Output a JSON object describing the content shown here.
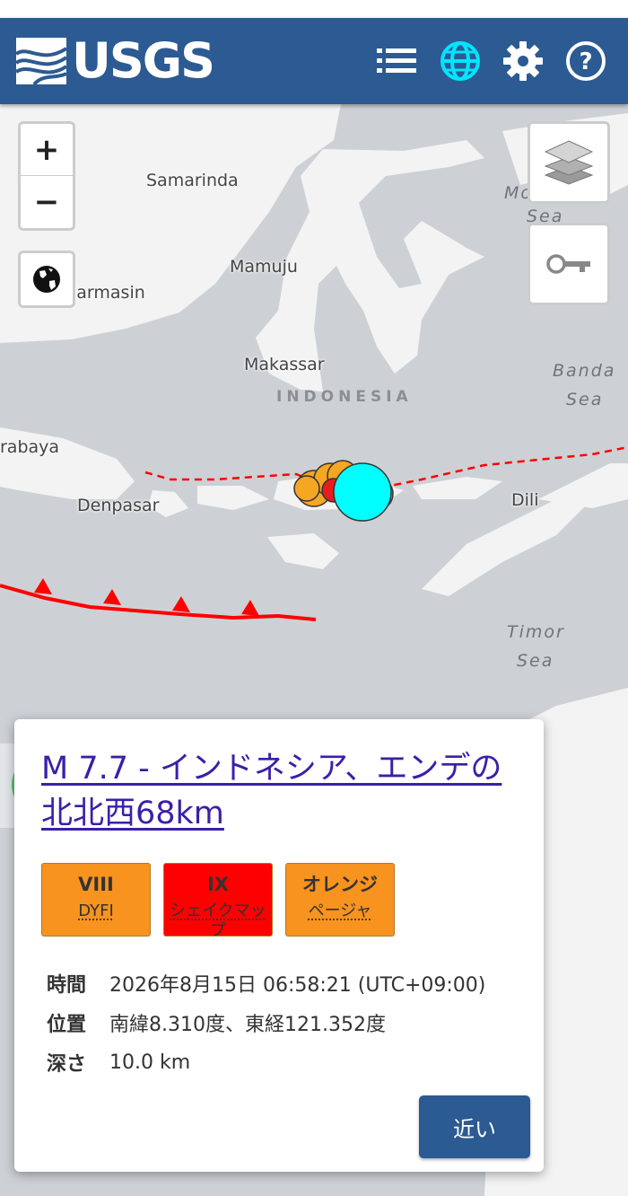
{
  "header": {
    "logo_text": "USGS",
    "icons": [
      "list-icon",
      "globe-icon",
      "gear-icon",
      "help-icon"
    ],
    "colors": {
      "bar": "#2c5a92",
      "active_icon": "#00e5ff"
    }
  },
  "map": {
    "controls": {
      "zoom_in": "+",
      "zoom_out": "−"
    },
    "labels": {
      "samarinda": "Samarinda",
      "banjarmasin": "jarmasin",
      "mamuju": "Mamuju",
      "makassar": "Makassar",
      "country": "INDONESIA",
      "surabaya": "rabaya",
      "denpasar": "Denpasar",
      "dili": "Dili",
      "molucca_1": "Mo",
      "molucca_2": "Sea",
      "banda_1": "Banda",
      "banda_2": "Sea",
      "timor_1": "Timor",
      "timor_2": "Sea"
    },
    "colors": {
      "land": "#f3f3f3",
      "water": "#cdd1d5",
      "fault": "#ff0000",
      "mainshock": "#00ffff",
      "aftershock": "#f5a623"
    }
  },
  "popup": {
    "title": "M 7.7 - インドネシア、エンデの北北西68km",
    "badges": [
      {
        "top": "VIII",
        "bottom": "DYFI",
        "color": "#f7931e"
      },
      {
        "top": "IX",
        "bottom": "シェイクマップ",
        "color": "#ff0000"
      },
      {
        "top": "オレンジ",
        "bottom": "ページャ",
        "color": "#f7931e"
      }
    ],
    "info": {
      "time_label": "時間",
      "time_value": "2026年8月15日 06:58:21 (UTC+09:00)",
      "location_label": "位置",
      "location_value": "南緯8.310度、東経121.352度",
      "depth_label": "深さ",
      "depth_value": "10.0 km"
    },
    "nearby_button": "近い"
  }
}
